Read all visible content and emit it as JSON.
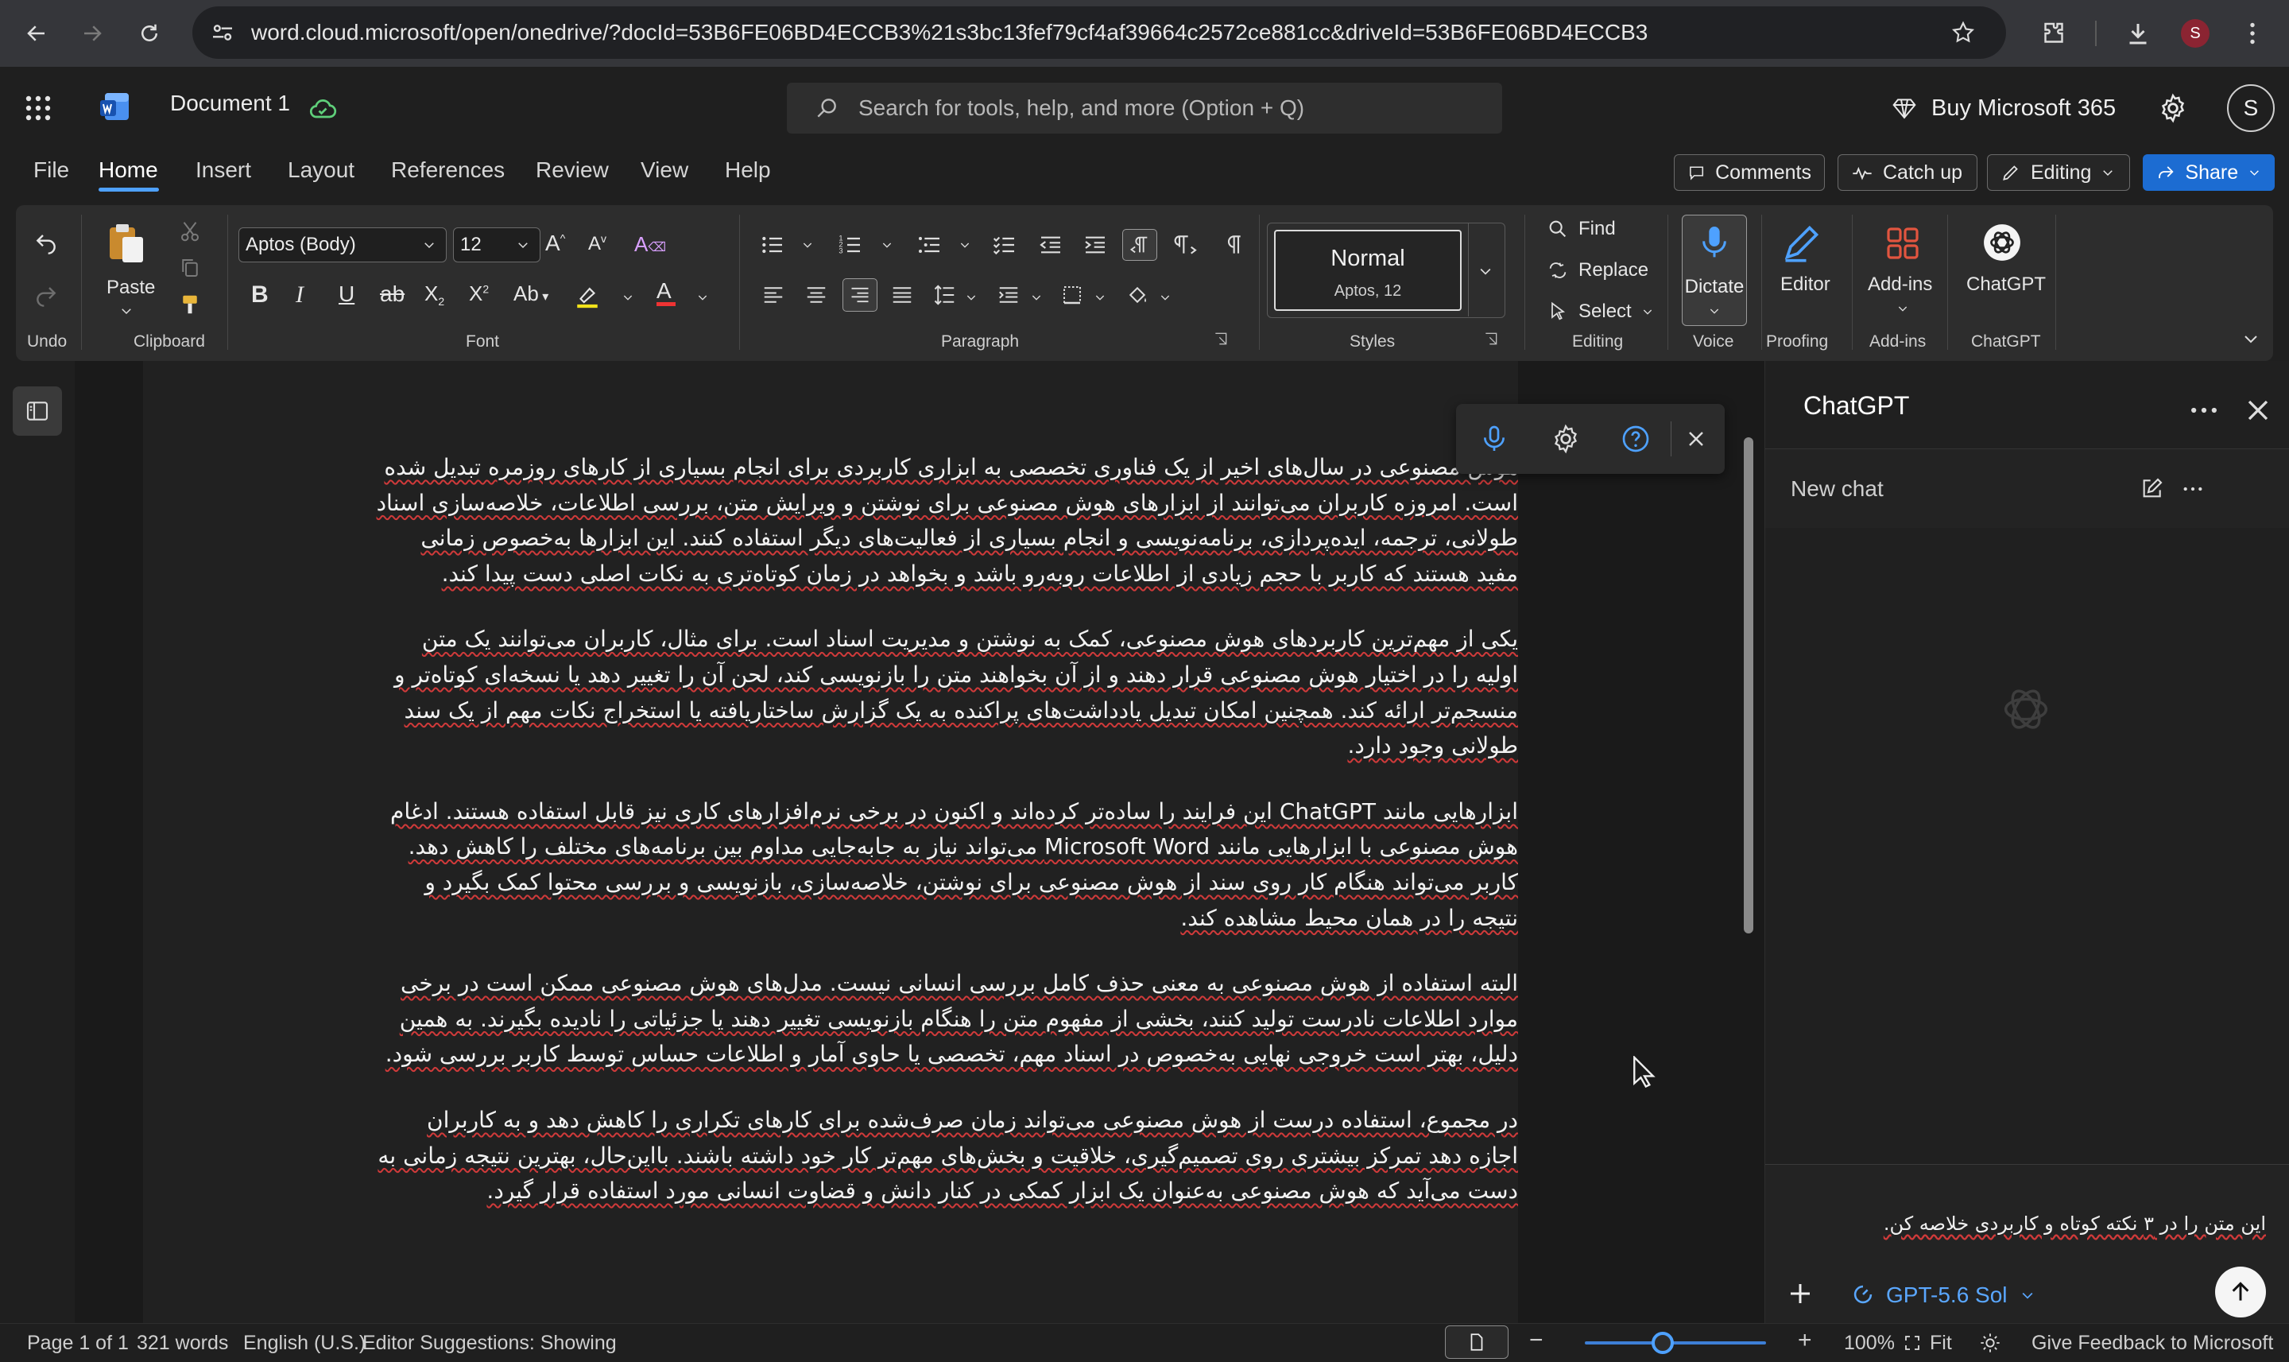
{
  "browser": {
    "url": "word.cloud.microsoft/open/onedrive/?docId=53B6FE06BD4ECCB3%21s3bc13fef79cf4af39664c2572ce881cc&driveId=53B6FE06BD4ECCB3",
    "profile_initial": "S"
  },
  "app": {
    "doc_title": "Document 1",
    "search_placeholder": "Search for tools, help, and more (Option + Q)",
    "buy_label": "Buy Microsoft 365",
    "user_initial": "S"
  },
  "menu": {
    "tabs": [
      "File",
      "Home",
      "Insert",
      "Layout",
      "References",
      "Review",
      "View",
      "Help"
    ],
    "active_tab": "Home",
    "comments_label": "Comments",
    "catchup_label": "Catch up",
    "editing_label": "Editing",
    "share_label": "Share"
  },
  "ribbon": {
    "undo_label": "Undo",
    "clipboard_label": "Clipboard",
    "paste_label": "Paste",
    "font_name": "Aptos (Body)",
    "font_size": "12",
    "font_label": "Font",
    "paragraph_label": "Paragraph",
    "style_name": "Normal",
    "style_sub": "Aptos, 12",
    "styles_label": "Styles",
    "find_label": "Find",
    "replace_label": "Replace",
    "select_label": "Select",
    "editing_group_label": "Editing",
    "dictate_label": "Dictate",
    "voice_label": "Voice",
    "editor_label": "Editor",
    "proofing_label": "Proofing",
    "addins_label": "Add-ins",
    "addins_group_label": "Add-ins",
    "chatgpt_label": "ChatGPT",
    "chatgpt_group_label": "ChatGPT"
  },
  "document": {
    "paragraphs": [
      "هوش مصنوعی در سال‌های اخیر از یک فناوری تخصصی به ابزاری کاربردی برای انجام بسیاری از کارهای روزمره تبدیل شده است. امروزه کاربران می‌توانند از ابزارهای هوش مصنوعی برای نوشتن و ویرایش متن، بررسی اطلاعات، خلاصه‌سازی اسناد طولانی، ترجمه، ایده‌پردازی، برنامه‌نویسی و انجام بسیاری از فعالیت‌های دیگر استفاده کنند. این ابزارها به‌خصوص زمانی مفید هستند که کاربر با حجم زیادی از اطلاعات روبه‌رو باشد و بخواهد در زمان کوتاه‌تری به نکات اصلی دست پیدا کند.",
      "یکی از مهم‌ترین کاربردهای هوش مصنوعی، کمک به نوشتن و مدیریت اسناد است. برای مثال، کاربران می‌توانند یک متن اولیه را در اختیار هوش مصنوعی قرار دهند و از آن بخواهند متن را بازنویسی کند، لحن آن را تغییر دهد یا نسخه‌ای کوتاه‌تر و منسجم‌تر ارائه کند. همچنین امکان تبدیل یادداشت‌های پراکنده به یک گزارش ساختاریافته یا استخراج نکات مهم از یک سند طولانی وجود دارد.",
      "ابزارهایی مانند ChatGPT این فرایند را ساده‌تر کرده‌اند و اکنون در برخی نرم‌افزارهای کاری نیز قابل استفاده هستند. ادغام هوش مصنوعی با ابزارهایی مانند Microsoft Word می‌تواند نیاز به جابه‌جایی مداوم بین برنامه‌های مختلف را کاهش دهد. کاربر می‌تواند هنگام کار روی سند از هوش مصنوعی برای نوشتن، خلاصه‌سازی، بازنویسی و بررسی محتوا کمک بگیرد و نتیجه را در همان محیط مشاهده کند.",
      "البته استفاده از هوش مصنوعی به معنی حذف کامل بررسی انسانی نیست. مدل‌های هوش مصنوعی ممکن است در برخی موارد اطلاعات نادرست تولید کنند، بخشی از مفهوم متن را هنگام بازنویسی تغییر دهند یا جزئیاتی را نادیده بگیرند. به همین دلیل، بهتر است خروجی نهایی به‌خصوص در اسناد مهم، تخصصی یا حاوی آمار و اطلاعات حساس توسط کاربر بررسی شود.",
      "در مجموع، استفاده درست از هوش مصنوعی می‌تواند زمان صرف‌شده برای کارهای تکراری را کاهش دهد و به کاربران اجازه دهد تمرکز بیشتری روی تصمیم‌گیری، خلاقیت و بخش‌های مهم‌تر کار خود داشته باشند. با‌این‌حال، بهترین نتیجه زمانی به دست می‌آید که هوش مصنوعی به‌عنوان یک ابزار کمکی در کنار دانش و قضاوت انسانی مورد استفاده قرار گیرد."
    ]
  },
  "chat": {
    "title": "ChatGPT",
    "new_chat_label": "New chat",
    "prompt_text": "این متن را در ۳ نکته کوتاه و کاربردی خلاصه کن.",
    "model_label": "GPT-5.6 Sol"
  },
  "status": {
    "page": "Page 1 of 1",
    "words": "321 words",
    "language": "English (U.S.)",
    "suggestions": "Editor Suggestions: Showing",
    "zoom": "100%",
    "fit_label": "Fit",
    "feedback": "Give Feedback to Microsoft",
    "zoom_level_percent": 100
  }
}
